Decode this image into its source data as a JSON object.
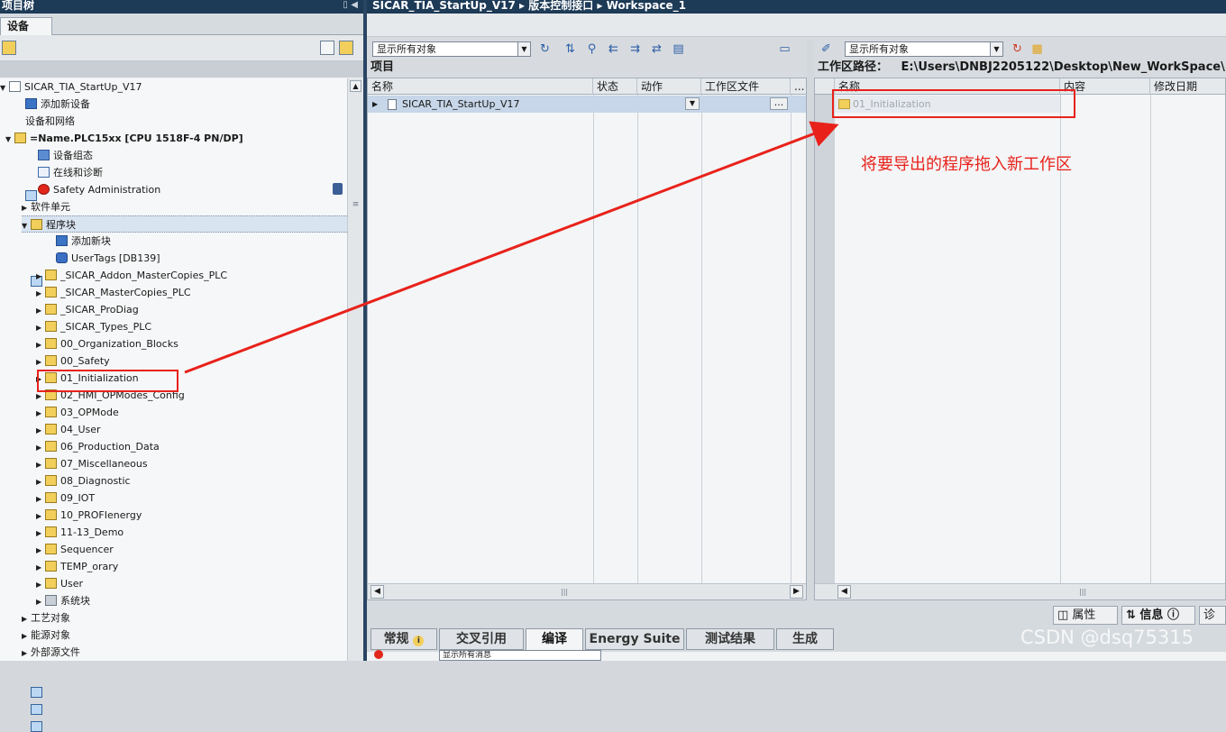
{
  "left": {
    "title": "项目树",
    "tab": "设备",
    "tree": [
      {
        "label": "SICAR_TIA_StartUp_V17",
        "icon": "doc",
        "tri": "▼",
        "bold": false
      },
      {
        "label": "添加新设备",
        "icon": "blue",
        "tri": "",
        "bold": false
      },
      {
        "label": "设备和网络",
        "icon": "grid",
        "tri": "",
        "bold": false
      },
      {
        "label": "=Name.PLC15xx [CPU 1518F-4 PN/DP]",
        "icon": "fold",
        "tri": "▼",
        "bold": true
      },
      {
        "label": "设备组态",
        "icon": "pc",
        "tri": "",
        "bold": false
      },
      {
        "label": "在线和诊断",
        "icon": "diag",
        "tri": "",
        "bold": false
      },
      {
        "label": "Safety Administration",
        "icon": "red",
        "tri": "",
        "bold": false
      },
      {
        "label": "软件单元",
        "icon": "grid",
        "tri": "▶",
        "bold": false
      },
      {
        "label": "程序块",
        "icon": "fold",
        "tri": "▼",
        "bold": false
      },
      {
        "label": "添加新块",
        "icon": "blue",
        "tri": "",
        "bold": false
      },
      {
        "label": "UserTags [DB139]",
        "icon": "cyl",
        "tri": "",
        "bold": false
      },
      {
        "label": "_SICAR_Addon_MasterCopies_PLC",
        "icon": "fold",
        "tri": "▶",
        "bold": false
      },
      {
        "label": "_SICAR_MasterCopies_PLC",
        "icon": "fold",
        "tri": "▶",
        "bold": false
      },
      {
        "label": "_SICAR_ProDiag",
        "icon": "fold",
        "tri": "▶",
        "bold": false
      },
      {
        "label": "_SICAR_Types_PLC",
        "icon": "fold",
        "tri": "▶",
        "bold": false
      },
      {
        "label": "00_Organization_Blocks",
        "icon": "fold",
        "tri": "▶",
        "bold": false
      },
      {
        "label": "00_Safety",
        "icon": "fold",
        "tri": "▶",
        "bold": false
      },
      {
        "label": "01_Initialization",
        "icon": "fold",
        "tri": "▶",
        "bold": false
      },
      {
        "label": "02_HMI_OPModes_Config",
        "icon": "fold",
        "tri": "▶",
        "bold": false
      },
      {
        "label": "03_OPMode",
        "icon": "fold",
        "tri": "▶",
        "bold": false
      },
      {
        "label": "04_User",
        "icon": "fold",
        "tri": "▶",
        "bold": false
      },
      {
        "label": "06_Production_Data",
        "icon": "fold",
        "tri": "▶",
        "bold": false
      },
      {
        "label": "07_Miscellaneous",
        "icon": "fold",
        "tri": "▶",
        "bold": false
      },
      {
        "label": "08_Diagnostic",
        "icon": "fold",
        "tri": "▶",
        "bold": false
      },
      {
        "label": "09_IOT",
        "icon": "fold",
        "tri": "▶",
        "bold": false
      },
      {
        "label": "10_PROFIenergy",
        "icon": "fold",
        "tri": "▶",
        "bold": false
      },
      {
        "label": "11-13_Demo",
        "icon": "fold",
        "tri": "▶",
        "bold": false
      },
      {
        "label": "Sequencer",
        "icon": "fold",
        "tri": "▶",
        "bold": false
      },
      {
        "label": "TEMP_orary",
        "icon": "fold",
        "tri": "▶",
        "bold": false
      },
      {
        "label": "User",
        "icon": "fold",
        "tri": "▶",
        "bold": false
      },
      {
        "label": "系统块",
        "icon": "gray",
        "tri": "▶",
        "bold": false
      },
      {
        "label": "工艺对象",
        "icon": "grid",
        "tri": "▶",
        "bold": false
      },
      {
        "label": "能源对象",
        "icon": "grid",
        "tri": "▶",
        "bold": false
      },
      {
        "label": "外部源文件",
        "icon": "grid",
        "tri": "▶",
        "bold": false
      }
    ]
  },
  "right": {
    "breadcrumb": "SICAR_TIA_StartUp_V17 ▸ 版本控制接口 ▸ Workspace_1",
    "project": {
      "filter": "显示所有对象",
      "title": "项目",
      "columns": [
        "名称",
        "状态",
        "动作",
        "工作区文件",
        "..."
      ],
      "row": {
        "name": "SICAR_TIA_StartUp_V17",
        "btn": "..."
      }
    },
    "workspace": {
      "filter": "显示所有对象",
      "path_label": "工作区路径：",
      "path": "E:\\Users\\DNBJ2205122\\Desktop\\New_WorkSpace\\",
      "columns": [
        "名称",
        "内容",
        "修改日期"
      ],
      "row": {
        "name": "01_Initialization"
      }
    }
  },
  "annotation": {
    "note": "将要导出的程序拖入新工作区",
    "color": "#e8221b"
  },
  "bottom": {
    "tabs": [
      "常规",
      "交叉引用",
      "编译",
      "Energy Suite",
      "测试结果",
      "生成"
    ],
    "active_tab": "编译",
    "right_tabs": [
      "属性",
      "信息",
      "诊"
    ],
    "filter": "显示所有消息",
    "watermark": "CSDN @dsq75315"
  }
}
